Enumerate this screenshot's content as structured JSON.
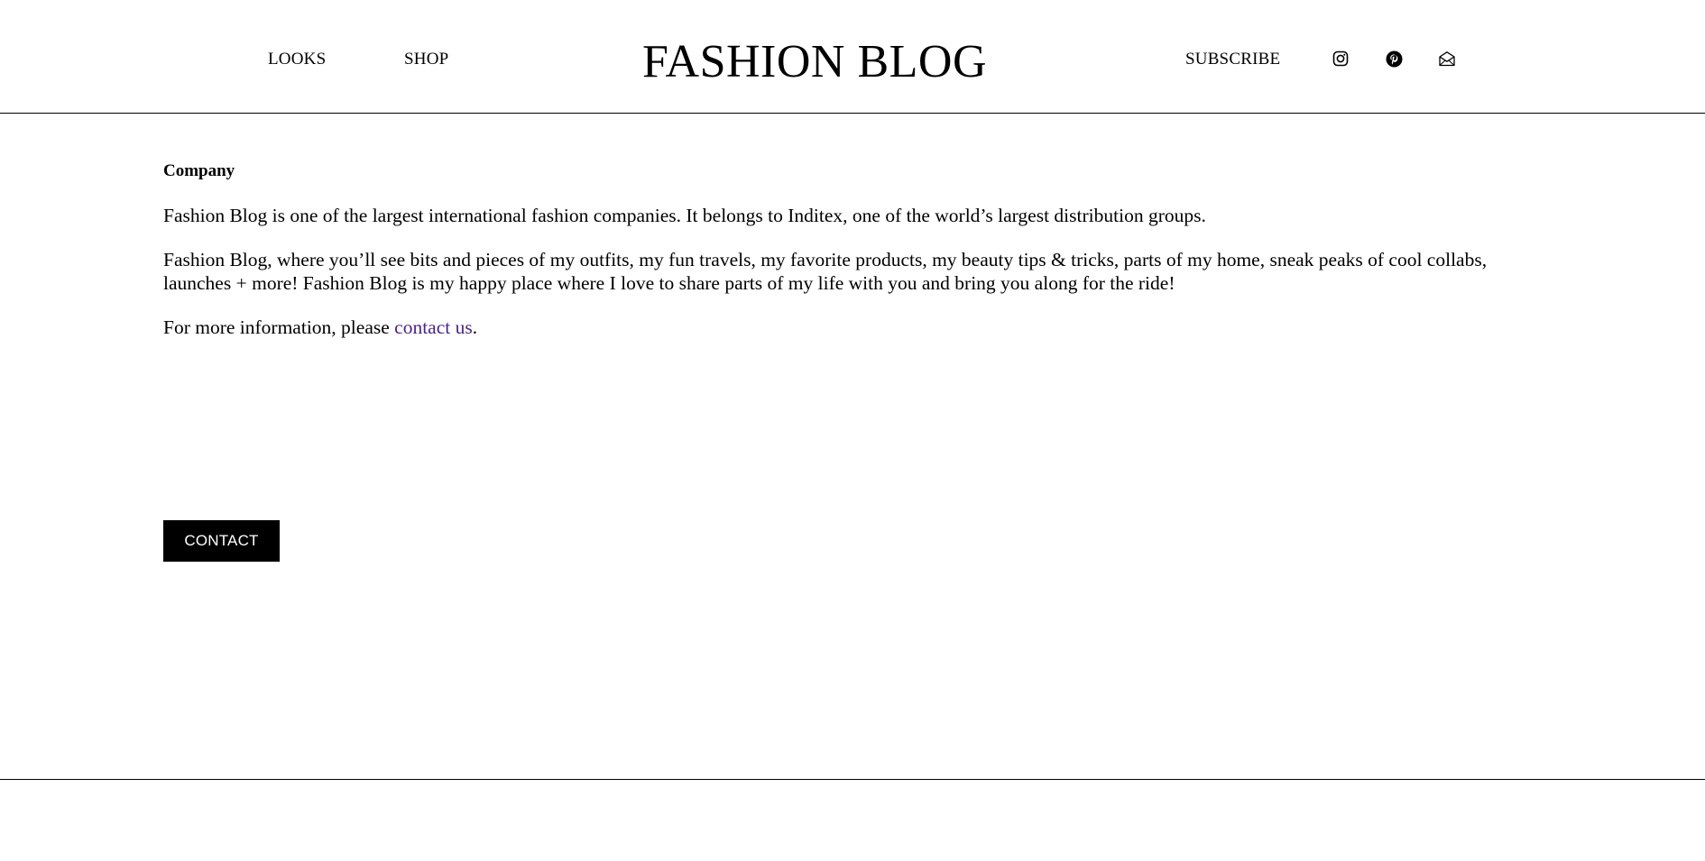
{
  "header": {
    "nav_left": {
      "looks": "LOOKS",
      "shop": "SHOP"
    },
    "logo": "FASHION BLOG",
    "nav_right": {
      "subscribe": "SUBSCRIBE"
    },
    "social_icons": [
      "instagram-icon",
      "pinterest-icon",
      "mail-icon"
    ]
  },
  "main": {
    "heading": "Company",
    "paragraph_1": "Fashion Blog is one of the largest international fashion companies. It belongs to Inditex, one of the world’s largest distribution groups.",
    "paragraph_2": "Fashion Blog, where you’ll see bits and pieces of my outfits, my fun travels, my favorite products, my beauty tips & tricks, parts of my home, sneak peaks of cool collabs, launches + more! Fashion Blog is my happy place where I love to share parts of my life with you and bring you along for the ride!",
    "paragraph_3_prefix": "For more information, please ",
    "paragraph_3_link": "contact us",
    "paragraph_3_suffix": ".",
    "contact_button": "CONTACT"
  },
  "colors": {
    "text": "#000000",
    "background": "#ffffff",
    "link": "#4b2386",
    "button_bg": "#000000",
    "button_text": "#ffffff"
  }
}
